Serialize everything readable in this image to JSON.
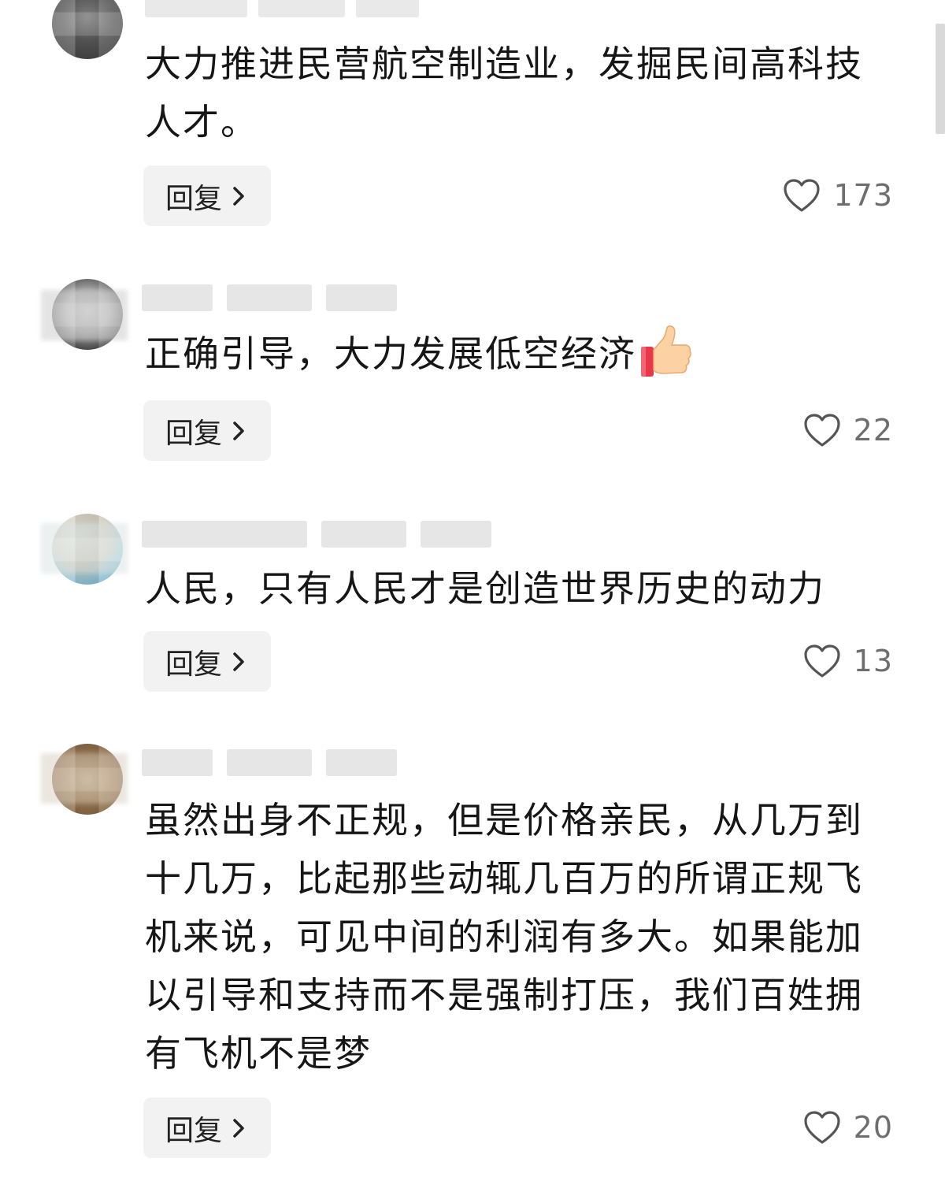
{
  "comments": [
    {
      "text": "大力推进民营航空制造业，发掘民间高科技人才。",
      "reply_label": "回复",
      "likes": "173"
    },
    {
      "text": "正确引导，大力发展低空经济",
      "emoji": "thumbs-up-icon",
      "reply_label": "回复",
      "likes": "22"
    },
    {
      "text": "人民，只有人民才是创造世界历史的动力",
      "reply_label": "回复",
      "likes": "13"
    },
    {
      "text": "虽然出身不正规，但是价格亲民，从几万到十几万，比起那些动辄几百万的所谓正规飞机来说，可见中间的利润有多大。如果能加以引导和支持而不是强制打压，我们百姓拥有飞机不是梦",
      "reply_label": "回复",
      "likes": "20"
    }
  ],
  "icons": {
    "like": "heart-outline-icon",
    "reply_arrow": "chevron-right-icon"
  },
  "colors": {
    "text": "#161616",
    "count": "#6e6e6e",
    "reply_bg": "#f2f2f2"
  }
}
